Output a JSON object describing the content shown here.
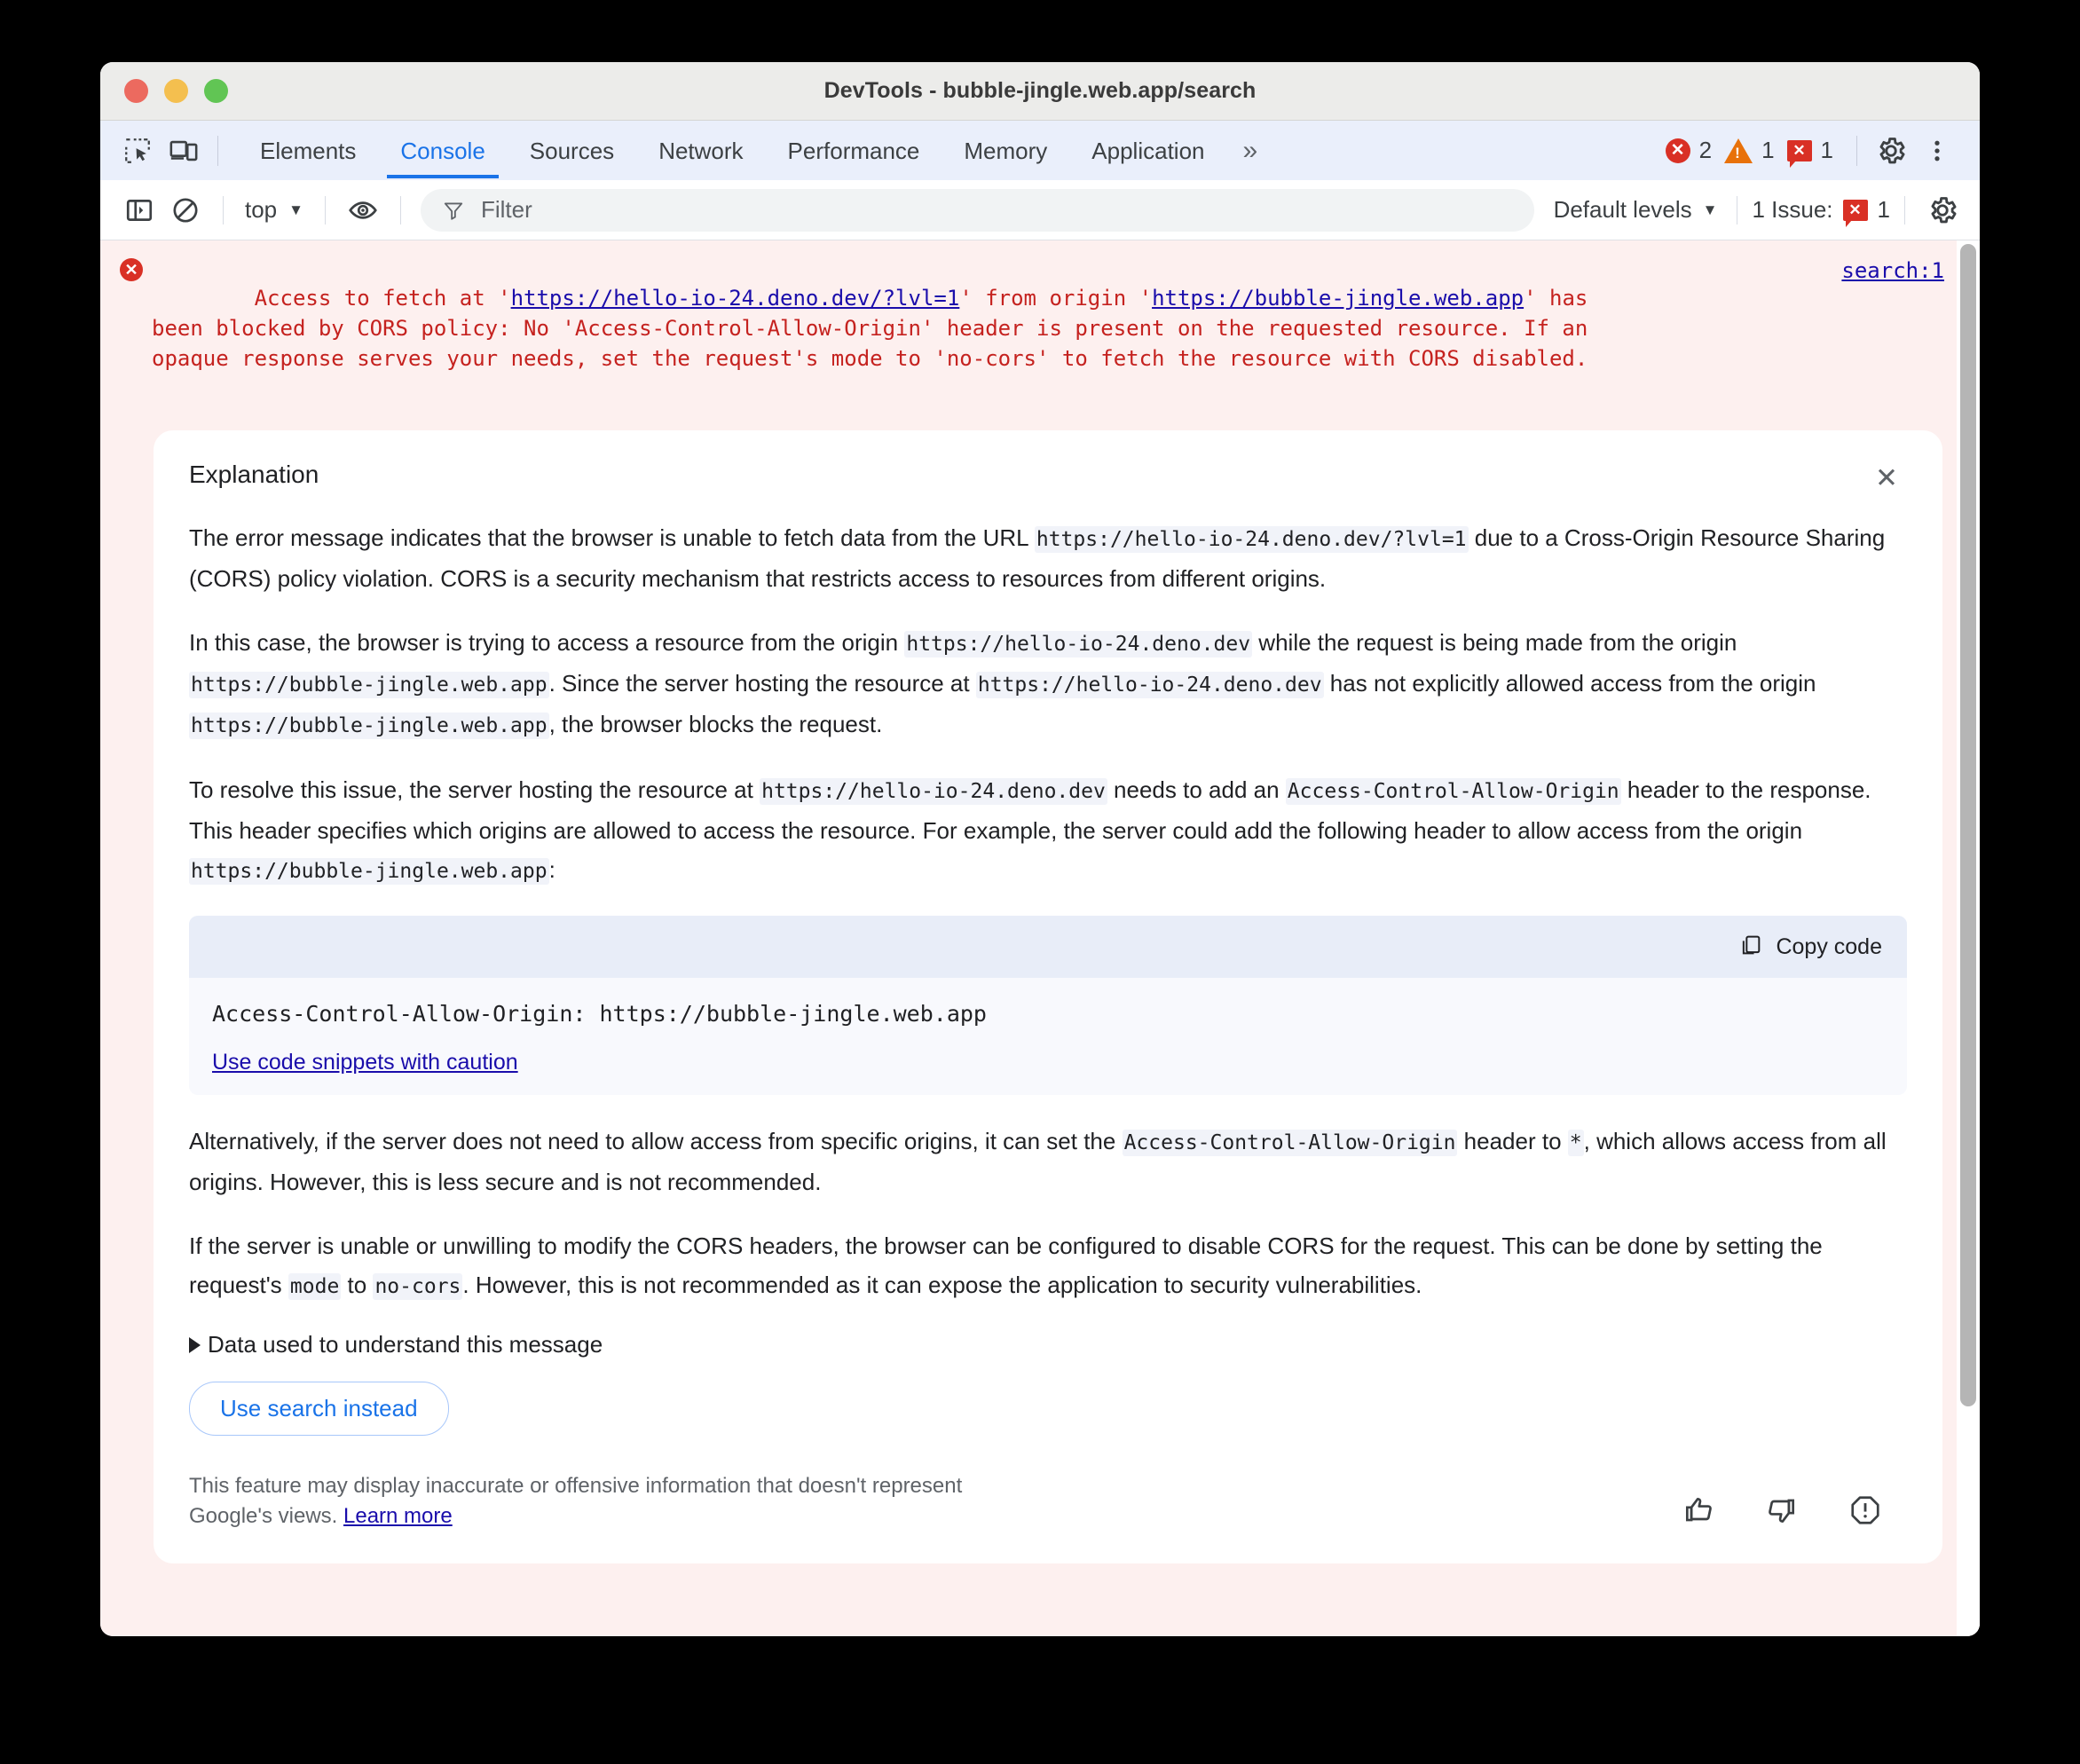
{
  "window": {
    "title": "DevTools - bubble-jingle.web.app/search"
  },
  "tabstrip": {
    "tabs": [
      {
        "label": "Elements",
        "active": false
      },
      {
        "label": "Console",
        "active": true
      },
      {
        "label": "Sources",
        "active": false
      },
      {
        "label": "Network",
        "active": false
      },
      {
        "label": "Performance",
        "active": false
      },
      {
        "label": "Memory",
        "active": false
      },
      {
        "label": "Application",
        "active": false
      }
    ],
    "overflow_label": "»",
    "error_count": "2",
    "warning_count": "1",
    "issue_count": "1",
    "error_glyph": "✕",
    "warning_glyph": "!",
    "issue_glyph": "✕"
  },
  "filterbar": {
    "context_label": "top",
    "context_caret": "▼",
    "filter_placeholder": "Filter",
    "levels_label": "Default levels",
    "levels_caret": "▼",
    "issues_label": "1 Issue:",
    "issues_count": "1",
    "issues_glyph": "✕"
  },
  "console": {
    "error_glyph": "✕",
    "error_parts": {
      "pre1": "Access to fetch at '",
      "url1": "https://hello-io-24.deno.dev/?lvl=1",
      "mid1": "' from origin '",
      "url2": "https://bubble-jingle.web.app",
      "post1": "' has\nbeen blocked by CORS policy: No 'Access-Control-Allow-Origin' header is present on the requested resource. If an\nopaque response serves your needs, set the request's mode to 'no-cors' to fetch the resource with CORS disabled."
    },
    "source_link": "search:1"
  },
  "explanation": {
    "title": "Explanation",
    "close_glyph": "✕",
    "p1": {
      "a": "The error message indicates that the browser is unable to fetch data from the URL ",
      "code": "https://hello-io-24.deno.dev/?lvl=1",
      "b": " due to a Cross-Origin Resource Sharing (CORS) policy violation. CORS is a security mechanism that restricts access to resources from different origins."
    },
    "p2": {
      "a": "In this case, the browser is trying to access a resource from the origin ",
      "code1": "https://hello-io-24.deno.dev",
      "b": " while the request is being made from the origin ",
      "code2": "https://bubble-jingle.web.app",
      "c": ". Since the server hosting the resource at ",
      "code3": "https://hello-io-24.deno.dev",
      "d": " has not explicitly allowed access from the origin ",
      "code4": "https://bubble-jingle.web.app",
      "e": ", the browser blocks the request."
    },
    "p3": {
      "a": "To resolve this issue, the server hosting the resource at ",
      "code1": "https://hello-io-24.deno.dev",
      "b": " needs to add an ",
      "code2": "Access-Control-Allow-Origin",
      "c": " header to the response. This header specifies which origins are allowed to access the resource. For example, the server could add the following header to allow access from the origin ",
      "code3": "https://bubble-jingle.web.app",
      "d": ":"
    },
    "codeblock": {
      "copy_label": "Copy code",
      "code": "Access-Control-Allow-Origin: https://bubble-jingle.web.app",
      "caution_link": "Use code snippets with caution"
    },
    "p4": {
      "a": "Alternatively, if the server does not need to allow access from specific origins, it can set the ",
      "code1": "Access-Control-Allow-Origin",
      "b": " header to ",
      "code2": "*",
      "c": ", which allows access from all origins. However, this is less secure and is not recommended."
    },
    "p5": {
      "a": "If the server is unable or unwilling to modify the CORS headers, the browser can be configured to disable CORS for the request. This can be done by setting the request's ",
      "code1": "mode",
      "b": " to ",
      "code2": "no-cors",
      "c": ". However, this is not recommended as it can expose the application to security vulnerabilities."
    },
    "data_used_label": "Data used to understand this message",
    "search_button": "Use search instead",
    "disclaimer": {
      "text": "This feature may display inaccurate or offensive information that doesn't represent Google's views. ",
      "link": "Learn more"
    }
  },
  "colors": {
    "accent": "#1a73e8",
    "error": "#d93025",
    "warning": "#e8710a",
    "link": "#1a0dab",
    "console_bg": "#fdf0ef"
  }
}
